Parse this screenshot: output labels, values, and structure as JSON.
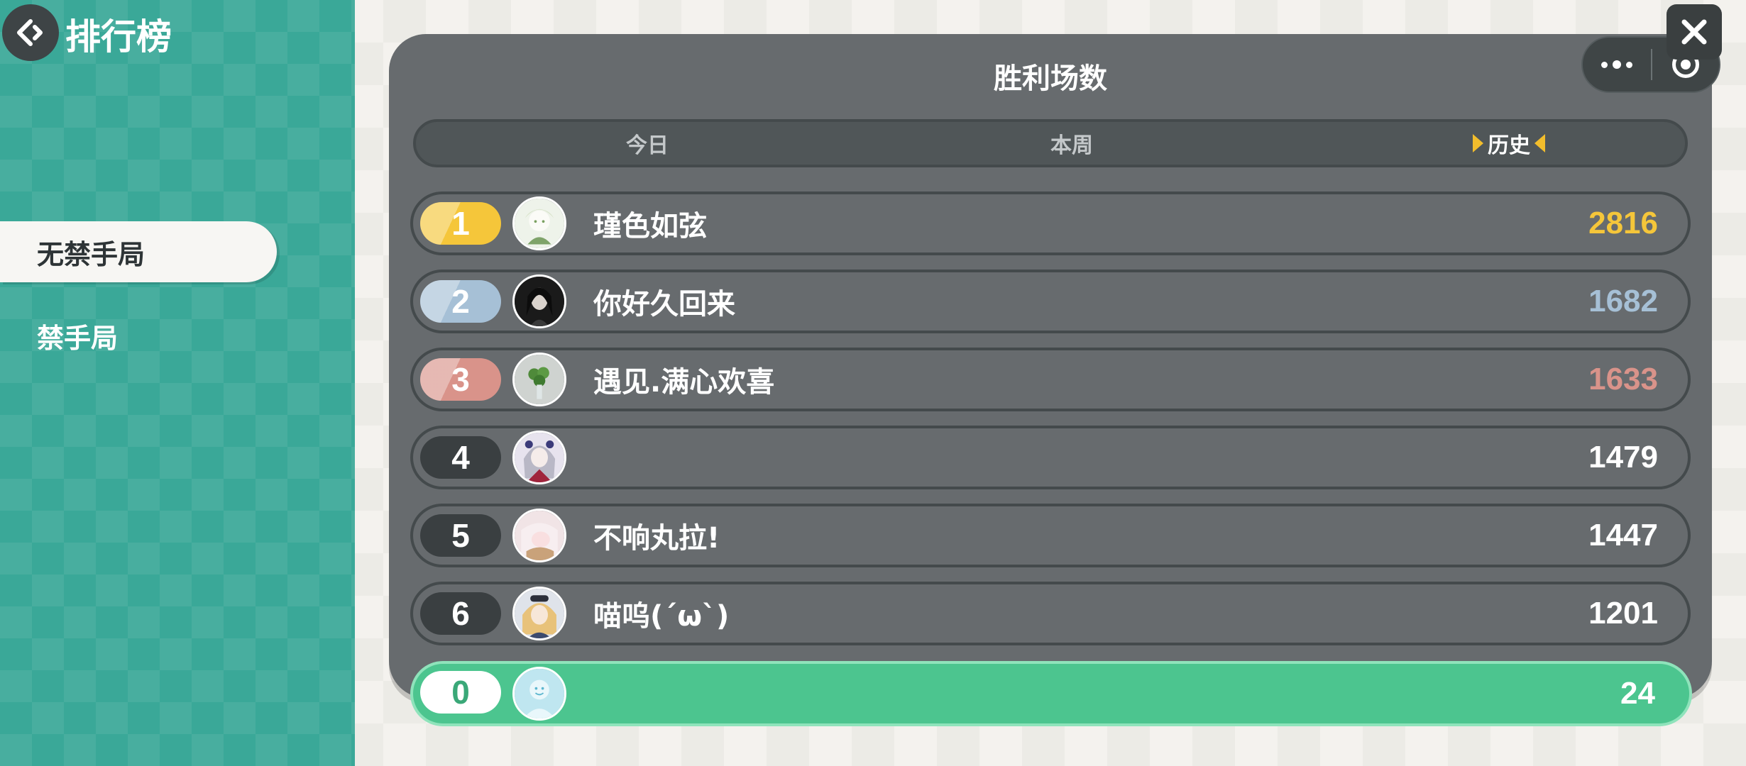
{
  "header": {
    "title": "排行榜",
    "back_icon": "back-arrow-icon"
  },
  "sidebar": {
    "items": [
      {
        "label": "无禁手局",
        "active": true
      },
      {
        "label": "禁手局",
        "active": false
      }
    ]
  },
  "capsule": {
    "more_icon": "more-dots-icon",
    "exit_icon": "target-circle-icon",
    "close_icon": "close-x-icon"
  },
  "panel": {
    "title": "胜利场数",
    "tabs": [
      {
        "label": "今日",
        "active": false
      },
      {
        "label": "本周",
        "active": false
      },
      {
        "label": "历史",
        "active": true
      }
    ]
  },
  "leaderboard": [
    {
      "rank": "1",
      "name": "瑾色如弦",
      "score": "2816",
      "badge_color": "#f5c63a",
      "score_color": "#f5c63a"
    },
    {
      "rank": "2",
      "name": "你好久回来",
      "score": "1682",
      "badge_color": "#a6c0d6",
      "score_color": "#a6c0d6"
    },
    {
      "rank": "3",
      "name": "遇见.满心欢喜",
      "score": "1633",
      "badge_color": "#d9938a",
      "score_color": "#d9938a"
    },
    {
      "rank": "4",
      "name": "",
      "score": "1479",
      "badge_color": "#3a3f41",
      "score_color": "#ffffff"
    },
    {
      "rank": "5",
      "name": "不响丸拉!",
      "score": "1447",
      "badge_color": "#3a3f41",
      "score_color": "#ffffff"
    },
    {
      "rank": "6",
      "name": "喵呜(´ω`)",
      "score": "1201",
      "badge_color": "#3a3f41",
      "score_color": "#ffffff"
    }
  ],
  "self_entry": {
    "rank": "0",
    "score": "24",
    "row_color": "#4cc58f"
  }
}
